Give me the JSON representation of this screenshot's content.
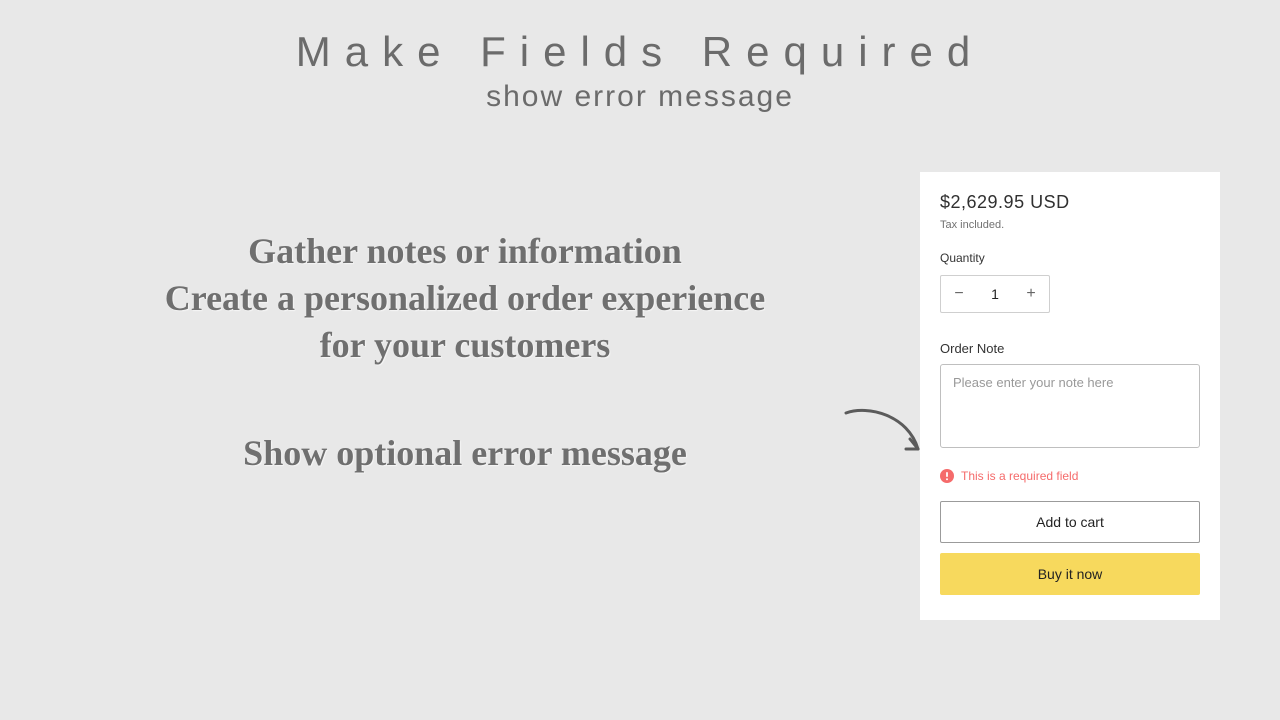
{
  "header": {
    "title": "Make Fields Required",
    "subtitle": "show error message"
  },
  "marketing": {
    "line1": "Gather notes or information",
    "line2": "Create a personalized order experience",
    "line3": "for your customers",
    "hint": "Show optional error message"
  },
  "product": {
    "price": "$2,629.95 USD",
    "tax_note": "Tax included.",
    "quantity_label": "Quantity",
    "quantity_value": "1",
    "minus_symbol": "−",
    "plus_symbol": "+",
    "order_note_label": "Order Note",
    "order_note_placeholder": "Please enter your note here",
    "error_message": "This is a required field",
    "add_to_cart_label": "Add to cart",
    "buy_now_label": "Buy it now"
  }
}
